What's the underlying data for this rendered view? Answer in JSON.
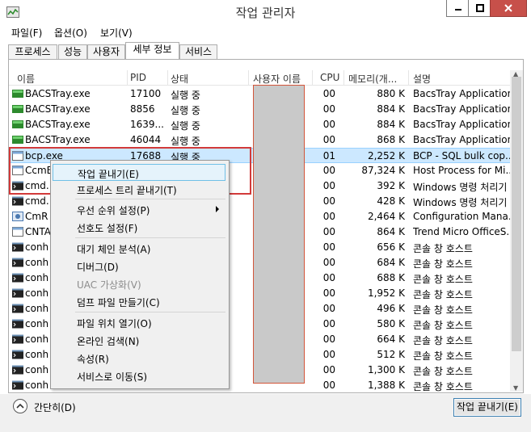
{
  "window": {
    "title": "작업 관리자"
  },
  "menu": [
    "파일(F)",
    "옵션(O)",
    "보기(V)"
  ],
  "tabs": [
    "프로세스",
    "성능",
    "사용자",
    "세부 정보",
    "서비스"
  ],
  "columns": {
    "name": "이름",
    "pid": "PID",
    "status": "상태",
    "user": "사용자 이름",
    "cpu": "CPU",
    "memory": "메모리(개...",
    "description": "설명"
  },
  "rows": [
    {
      "name": "BACSTray.exe",
      "pid": "17100",
      "status": "실행 중",
      "cpu": "00",
      "memory": "880 K",
      "desc": "BacsTray Application",
      "icon": "bacstray-icon"
    },
    {
      "name": "BACSTray.exe",
      "pid": "8856",
      "status": "실행 중",
      "cpu": "00",
      "memory": "884 K",
      "desc": "BacsTray Application",
      "icon": "bacstray-icon"
    },
    {
      "name": "BACSTray.exe",
      "pid": "1639...",
      "status": "실행 중",
      "cpu": "00",
      "memory": "884 K",
      "desc": "BacsTray Application",
      "icon": "bacstray-icon"
    },
    {
      "name": "BACSTray.exe",
      "pid": "46044",
      "status": "실행 중",
      "cpu": "00",
      "memory": "868 K",
      "desc": "BacsTray Application",
      "icon": "bacstray-icon"
    },
    {
      "name": "bcp.exe",
      "pid": "17688",
      "status": "실행 중",
      "cpu": "01",
      "memory": "2,252 K",
      "desc": "BCP - SQL bulk cop...",
      "icon": "app-window-icon"
    },
    {
      "name": "CcmE",
      "pid": "",
      "status": "",
      "cpu": "00",
      "memory": "87,324 K",
      "desc": "Host Process for Mi...",
      "icon": "app-window-icon"
    },
    {
      "name": "cmd.",
      "pid": "",
      "status": "",
      "cpu": "00",
      "memory": "392 K",
      "desc": "Windows 명령 처리기",
      "icon": "console-icon"
    },
    {
      "name": "cmd.",
      "pid": "",
      "status": "",
      "cpu": "00",
      "memory": "428 K",
      "desc": "Windows 명령 처리기",
      "icon": "console-icon"
    },
    {
      "name": "CmR",
      "pid": "",
      "status": "",
      "cpu": "00",
      "memory": "2,464 K",
      "desc": "Configuration Mana...",
      "icon": "config-icon"
    },
    {
      "name": "CNTA",
      "pid": "",
      "status": "",
      "cpu": "00",
      "memory": "864 K",
      "desc": "Trend Micro OfficeS...",
      "icon": "app-window-icon"
    },
    {
      "name": "conh",
      "pid": "",
      "status": "",
      "cpu": "00",
      "memory": "656 K",
      "desc": "콘솔 창 호스트",
      "icon": "console-icon"
    },
    {
      "name": "conh",
      "pid": "",
      "status": "",
      "cpu": "00",
      "memory": "684 K",
      "desc": "콘솔 창 호스트",
      "icon": "console-icon"
    },
    {
      "name": "conh",
      "pid": "",
      "status": "",
      "cpu": "00",
      "memory": "688 K",
      "desc": "콘솔 창 호스트",
      "icon": "console-icon"
    },
    {
      "name": "conh",
      "pid": "",
      "status": "",
      "cpu": "00",
      "memory": "1,952 K",
      "desc": "콘솔 창 호스트",
      "icon": "console-icon"
    },
    {
      "name": "conh",
      "pid": "",
      "status": "",
      "cpu": "00",
      "memory": "496 K",
      "desc": "콘솔 창 호스트",
      "icon": "console-icon"
    },
    {
      "name": "conh",
      "pid": "",
      "status": "",
      "cpu": "00",
      "memory": "580 K",
      "desc": "콘솔 창 호스트",
      "icon": "console-icon"
    },
    {
      "name": "conh",
      "pid": "",
      "status": "",
      "cpu": "00",
      "memory": "664 K",
      "desc": "콘솔 창 호스트",
      "icon": "console-icon"
    },
    {
      "name": "conh",
      "pid": "",
      "status": "",
      "cpu": "00",
      "memory": "512 K",
      "desc": "콘솔 창 호스트",
      "icon": "console-icon"
    },
    {
      "name": "conh",
      "pid": "",
      "status": "",
      "cpu": "00",
      "memory": "1,300 K",
      "desc": "콘솔 창 호스트",
      "icon": "console-icon"
    },
    {
      "name": "conh",
      "pid": "",
      "status": "",
      "cpu": "00",
      "memory": "1,388 K",
      "desc": "콘솔 창 호스트",
      "icon": "console-icon"
    }
  ],
  "context_menu": {
    "items": [
      {
        "label": "작업 끝내기(E)",
        "state": "highlighted"
      },
      {
        "label": "프로세스 트리 끝내기(T)",
        "state": "normal"
      },
      {
        "label": "우선 순위 설정(P)",
        "state": "submenu"
      },
      {
        "label": "선호도 설정(F)",
        "state": "normal"
      },
      {
        "label": "대기 체인 분석(A)",
        "state": "normal"
      },
      {
        "label": "디버그(D)",
        "state": "normal"
      },
      {
        "label": "UAC 가상화(V)",
        "state": "disabled"
      },
      {
        "label": "덤프 파일 만들기(C)",
        "state": "normal"
      },
      {
        "label": "파일 위치 열기(O)",
        "state": "normal"
      },
      {
        "label": "온라인 검색(N)",
        "state": "normal"
      },
      {
        "label": "속성(R)",
        "state": "normal"
      },
      {
        "label": "서비스로 이동(S)",
        "state": "normal"
      }
    ]
  },
  "footer": {
    "fewer_details": "간단히(D)",
    "end_task": "작업 끝내기(E)"
  },
  "colors": {
    "selection": "#cce8ff",
    "annotation_red": "#d23a3a",
    "close_button": "#c7504a"
  }
}
